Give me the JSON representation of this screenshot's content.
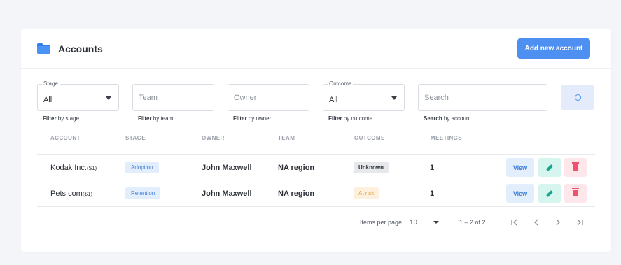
{
  "header": {
    "title": "Accounts",
    "add_button_label": "Add new account",
    "folder_icon_color": "#2f80ed"
  },
  "filters": {
    "stage": {
      "label": "Stage",
      "value": "All",
      "hint_strong": "Filter",
      "hint_rest": " by stage"
    },
    "team": {
      "placeholder": "Team",
      "hint_strong": "Filter",
      "hint_rest": " by team"
    },
    "owner": {
      "placeholder": "Owner",
      "hint_strong": "Filter",
      "hint_rest": " by owner"
    },
    "outcome": {
      "label": "Outcome",
      "value": "All",
      "hint_strong": "Filter",
      "hint_rest": " by outcome"
    },
    "search": {
      "placeholder": "Search",
      "hint_strong": "Search",
      "hint_rest": " by account"
    },
    "search_button_icon": "search-icon"
  },
  "table": {
    "columns": [
      "ACCOUNT",
      "STAGE",
      "OWNER",
      "TEAM",
      "OUTCOME",
      "MEETINGS"
    ],
    "rows": [
      {
        "account": "Kodak Inc.",
        "account_id": "($1)",
        "stage": "Adoption",
        "owner": "John Maxwell",
        "team": "NA region",
        "outcome": "Unknown",
        "meetings": "1"
      },
      {
        "account": "Pets.com",
        "account_id": "($1)",
        "stage": "Retention",
        "owner": "John Maxwell",
        "team": "NA region",
        "outcome": "At risk",
        "meetings": "1"
      }
    ],
    "actions": {
      "view_label": "View",
      "edit_icon": "pencil-icon",
      "delete_icon": "trash-icon"
    }
  },
  "pagination": {
    "items_per_page_label": "Items per page",
    "items_per_page_value": "10",
    "range_label": "1 – 2 of 2",
    "first_icon": "first-page-icon",
    "prev_icon": "prev-page-icon",
    "next_icon": "next-page-icon",
    "last_icon": "last-page-icon"
  },
  "colors": {
    "accent": "#4e8ff2",
    "badge_blue_bg": "#e3eefc",
    "at_risk_text": "#e3a23a",
    "edit_green": "#16a88c",
    "delete_red": "#f0506e"
  }
}
